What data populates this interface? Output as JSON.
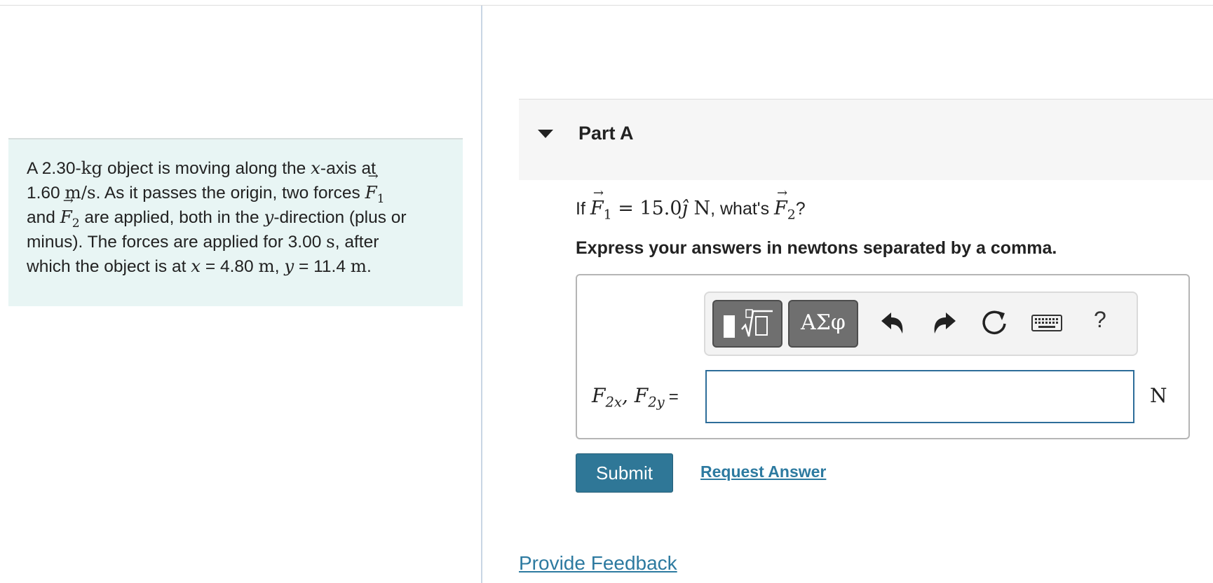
{
  "problem": {
    "t1": "A 2.30-",
    "t2": "kg",
    "t3": " object is moving along the ",
    "t4": "x",
    "t5": "-axis at",
    "t6": "1.60 ",
    "t7": "m/s",
    "t8": ". As it passes the origin, two forces ",
    "t9": "F",
    "t10": "1",
    "t11": "and ",
    "t12": "F",
    "t13": "2",
    "t14": " are applied, both in the ",
    "t15": "y",
    "t16": "-direction (plus or",
    "t17": "minus). The forces are applied for 3.00 ",
    "t18": "s",
    "t19": ", after",
    "t20": "which the object is at ",
    "t21": "x",
    "t22": " = 4.80 ",
    "t23": "m",
    "t24": ", ",
    "t25": "y",
    "t26": " = 11.4 ",
    "t27": "m",
    "t28": "."
  },
  "part": {
    "title": "Part A",
    "q_if": "If ",
    "q_F": "F",
    "q_sub1": "1",
    "q_eq": " = 15.0",
    "q_j": "ĵ",
    "q_unit": " N",
    "q_whats": ", what's ",
    "q_F2": "F",
    "q_sub2": "2",
    "q_end": "?",
    "instruction": "Express your answers in newtons separated by a comma."
  },
  "toolbar": {
    "greek_label": "ΑΣφ",
    "help_label": "?",
    "icons": [
      "templates-icon",
      "greek-letters-icon",
      "undo-icon",
      "redo-icon",
      "reset-icon",
      "keyboard-icon",
      "help-icon"
    ]
  },
  "answer": {
    "label_F1": "F",
    "label_sub1": "2x",
    "label_comma": ", ",
    "label_F2": "F",
    "label_sub2": "2y",
    "label_eq": "=",
    "value": "",
    "unit": "N"
  },
  "actions": {
    "submit": "Submit",
    "request": "Request Answer",
    "feedback": "Provide Feedback"
  },
  "colors": {
    "panel_bg": "#e8f5f4",
    "accent": "#2f7797",
    "link": "#2d7aa0",
    "input_border": "#2d6d99"
  }
}
